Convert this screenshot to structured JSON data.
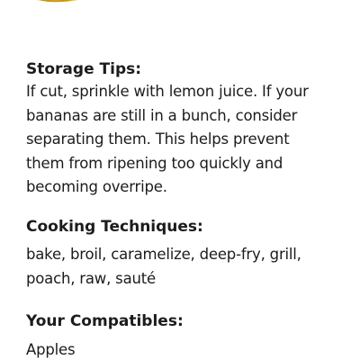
{
  "image": {
    "icon": "banana-bunch-icon"
  },
  "storage_tips": {
    "heading": "Storage Tips:",
    "lines": [
      "If cut, sprinkle with lemon juice.  If your",
      "bananas are still in a bunch, consider",
      "separating them. This helps prevent",
      "them from ripening too quickly and",
      "becoming overripe."
    ]
  },
  "cooking_techniques": {
    "heading": "Cooking Techniques:",
    "lines": [
      "bake, broil, caramelize, deep-fry, grill,",
      "poach, raw, sauté"
    ]
  },
  "compatibles": {
    "heading": "Your Compatibles:",
    "value": "Apples"
  }
}
